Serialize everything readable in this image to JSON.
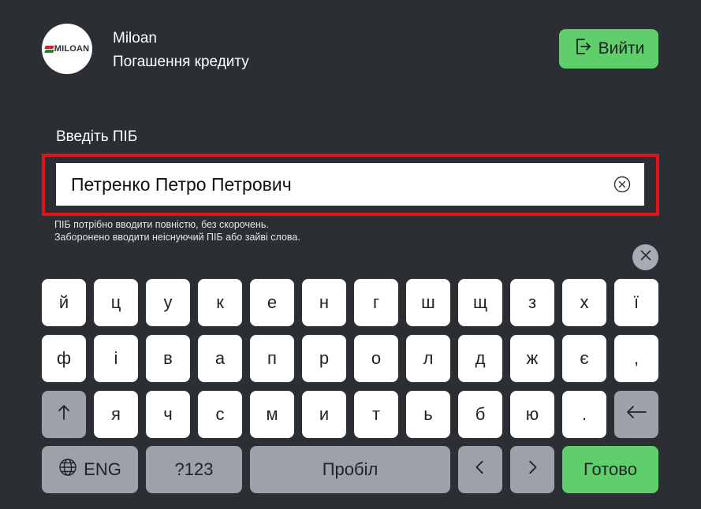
{
  "header": {
    "logo_text": "MILOAN",
    "brand_name": "Miloan",
    "subtitle": "Погашення кредиту",
    "exit_label": "Вийти"
  },
  "form": {
    "label": "Введіть ПІБ",
    "value": "Петренко Петро Петрович",
    "hint_line1": "ПІБ потрібно вводити повністю, без скорочень.",
    "hint_line2": "Заборонено вводити неіснуючий ПІБ або зайві слова."
  },
  "keyboard": {
    "row1": [
      "й",
      "ц",
      "у",
      "к",
      "е",
      "н",
      "г",
      "ш",
      "щ",
      "з",
      "х",
      "ї"
    ],
    "row2": [
      "ф",
      "і",
      "в",
      "а",
      "п",
      "р",
      "о",
      "л",
      "д",
      "ж",
      "є",
      ","
    ],
    "row3": [
      "я",
      "ч",
      "с",
      "м",
      "и",
      "т",
      "ь",
      "б",
      "ю",
      "."
    ],
    "lang_label": "ENG",
    "symbols_label": "?123",
    "space_label": "Пробіл",
    "done_label": "Готово"
  },
  "colors": {
    "background": "#2b2f34",
    "accent_green": "#5fcf6b",
    "highlight_red": "#e3121b",
    "key_gray": "#9da1aa"
  }
}
